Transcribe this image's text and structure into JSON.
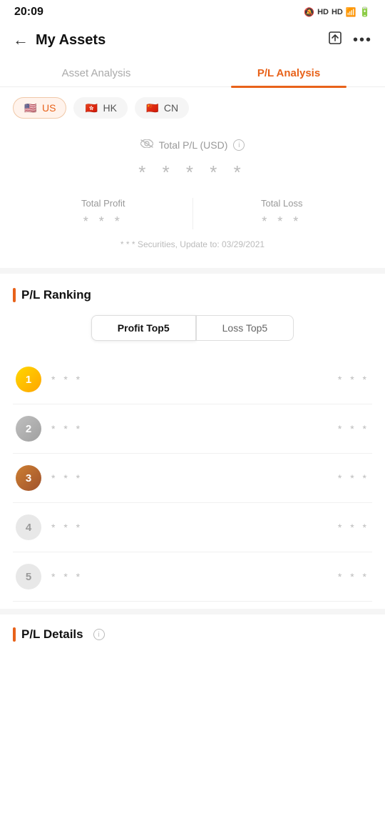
{
  "statusBar": {
    "time": "20:09",
    "icons": [
      "🔕",
      "HD",
      "HD",
      "📶",
      "🔋"
    ]
  },
  "header": {
    "title": "My Assets",
    "backLabel": "‹",
    "exportIconLabel": "export",
    "moreIconLabel": "more"
  },
  "tabs": [
    {
      "id": "asset-analysis",
      "label": "Asset Analysis",
      "active": false
    },
    {
      "id": "pl-analysis",
      "label": "P/L Analysis",
      "active": true
    }
  ],
  "marketFilter": [
    {
      "id": "us",
      "label": "US",
      "flag": "🇺🇸",
      "active": true
    },
    {
      "id": "hk",
      "label": "HK",
      "flag": "🇭🇰",
      "active": false
    },
    {
      "id": "cn",
      "label": "CN",
      "flag": "🇨🇳",
      "active": false
    }
  ],
  "plSummary": {
    "eyeIcon": "👁",
    "label": "Total P/L (USD)",
    "infoIcon": "i",
    "maskedValue": "* * * * *",
    "totalProfit": {
      "label": "Total Profit",
      "maskedValue": "* * *"
    },
    "totalLoss": {
      "label": "Total Loss",
      "maskedValue": "* * *"
    },
    "note": "* * * Securities, Update to: 03/29/2021"
  },
  "plRanking": {
    "sectionTitle": "P/L Ranking",
    "toggleButtons": [
      {
        "id": "profit-top5",
        "label": "Profit Top5",
        "active": true
      },
      {
        "id": "loss-top5",
        "label": "Loss Top5",
        "active": false
      }
    ],
    "rankingItems": [
      {
        "rank": 1,
        "name": "* * *",
        "value": "* * *"
      },
      {
        "rank": 2,
        "name": "* * *",
        "value": "* * *"
      },
      {
        "rank": 3,
        "name": "* * *",
        "value": "* * *"
      },
      {
        "rank": 4,
        "name": "* * *",
        "value": "* * *"
      },
      {
        "rank": 5,
        "name": "* * *",
        "value": "* * *"
      }
    ]
  },
  "plDetails": {
    "sectionTitle": "P/L Details",
    "infoIcon": "i"
  }
}
